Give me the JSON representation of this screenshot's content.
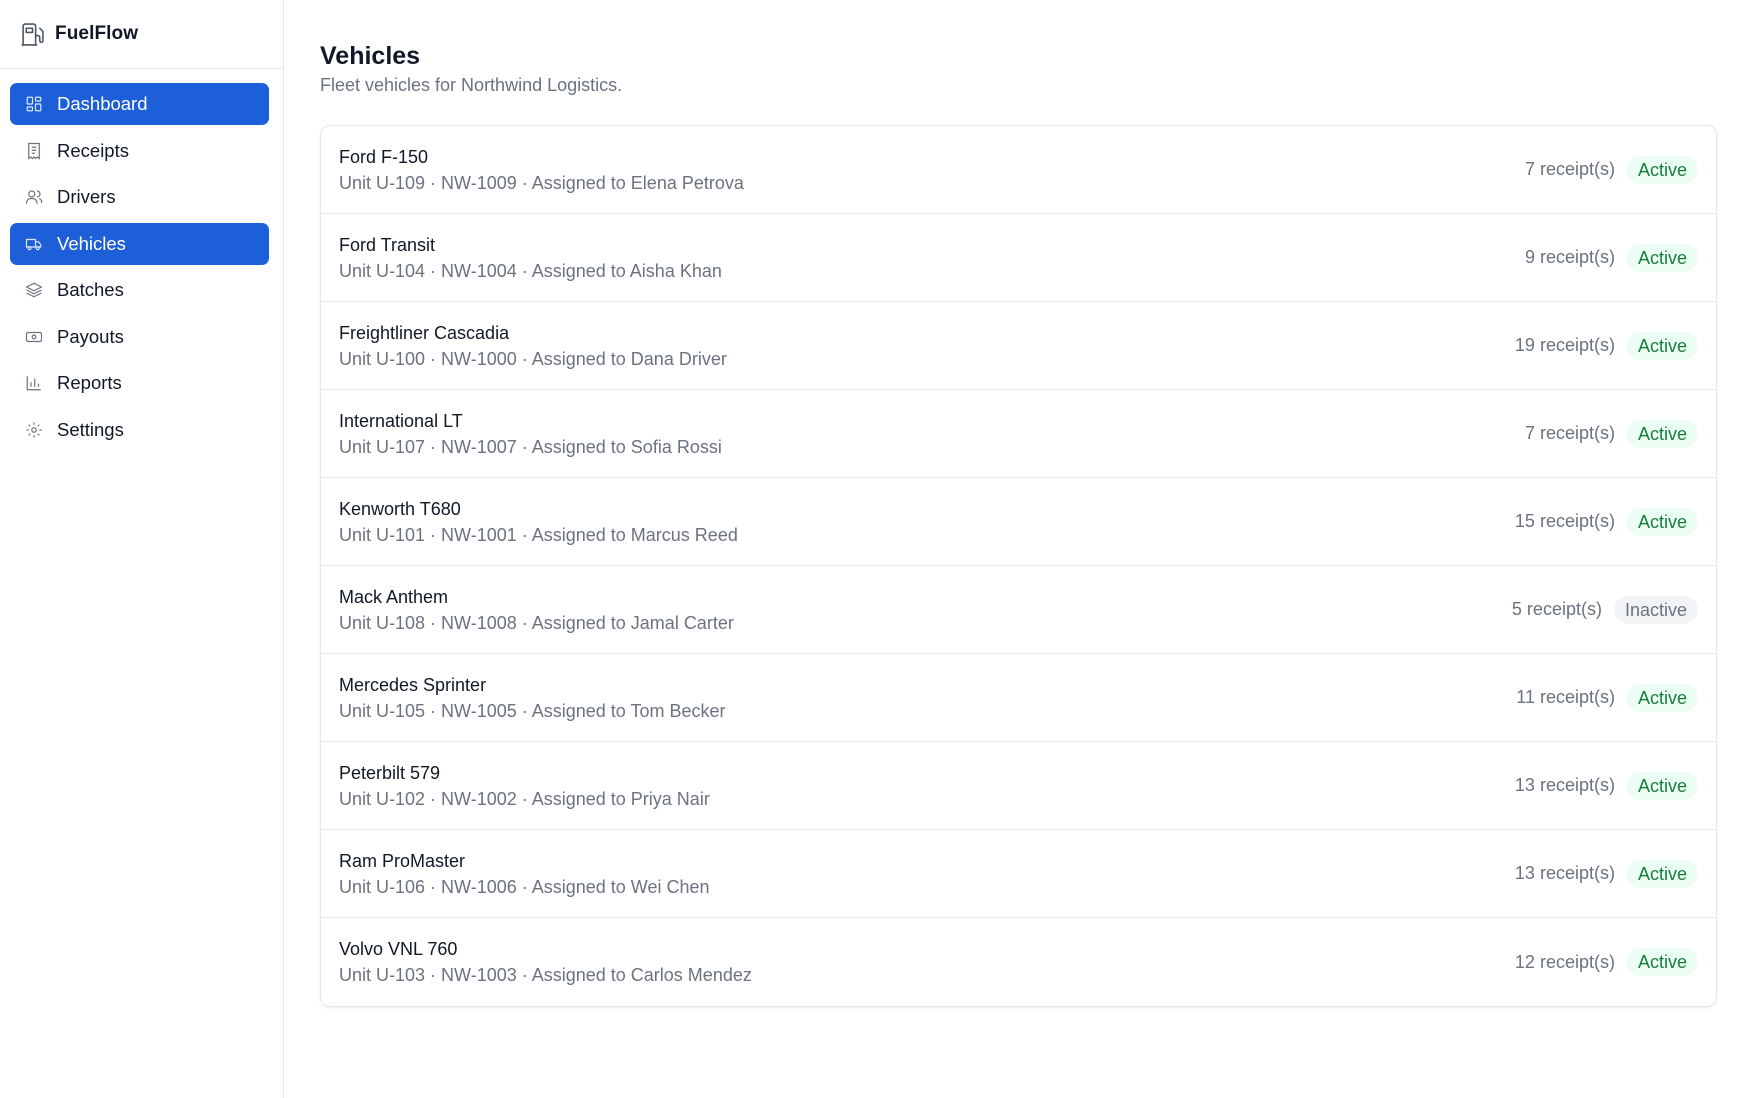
{
  "app": {
    "name": "FuelFlow"
  },
  "sidebar": {
    "items": [
      {
        "label": "Dashboard",
        "icon": "dashboard-icon",
        "active": true
      },
      {
        "label": "Receipts",
        "icon": "receipt-icon",
        "active": false
      },
      {
        "label": "Drivers",
        "icon": "users-icon",
        "active": false
      },
      {
        "label": "Vehicles",
        "icon": "truck-icon",
        "active": true
      },
      {
        "label": "Batches",
        "icon": "layers-icon",
        "active": false
      },
      {
        "label": "Payouts",
        "icon": "banknote-icon",
        "active": false
      },
      {
        "label": "Reports",
        "icon": "bar-chart-icon",
        "active": false
      },
      {
        "label": "Settings",
        "icon": "gear-icon",
        "active": false
      }
    ]
  },
  "page": {
    "title": "Vehicles",
    "subtitle": "Fleet vehicles for Northwind Logistics."
  },
  "vehicles": [
    {
      "name": "Ford F-150",
      "meta": "Unit U-109 · NW-1009 · Assigned to Elena Petrova",
      "receipts": "7 receipt(s)",
      "status": "Active"
    },
    {
      "name": "Ford Transit",
      "meta": "Unit U-104 · NW-1004 · Assigned to Aisha Khan",
      "receipts": "9 receipt(s)",
      "status": "Active"
    },
    {
      "name": "Freightliner Cascadia",
      "meta": "Unit U-100 · NW-1000 · Assigned to Dana Driver",
      "receipts": "19 receipt(s)",
      "status": "Active"
    },
    {
      "name": "International LT",
      "meta": "Unit U-107 · NW-1007 · Assigned to Sofia Rossi",
      "receipts": "7 receipt(s)",
      "status": "Active"
    },
    {
      "name": "Kenworth T680",
      "meta": "Unit U-101 · NW-1001 · Assigned to Marcus Reed",
      "receipts": "15 receipt(s)",
      "status": "Active"
    },
    {
      "name": "Mack Anthem",
      "meta": "Unit U-108 · NW-1008 · Assigned to Jamal Carter",
      "receipts": "5 receipt(s)",
      "status": "Inactive"
    },
    {
      "name": "Mercedes Sprinter",
      "meta": "Unit U-105 · NW-1005 · Assigned to Tom Becker",
      "receipts": "11 receipt(s)",
      "status": "Active"
    },
    {
      "name": "Peterbilt 579",
      "meta": "Unit U-102 · NW-1002 · Assigned to Priya Nair",
      "receipts": "13 receipt(s)",
      "status": "Active"
    },
    {
      "name": "Ram ProMaster",
      "meta": "Unit U-106 · NW-1006 · Assigned to Wei Chen",
      "receipts": "13 receipt(s)",
      "status": "Active"
    },
    {
      "name": "Volvo VNL 760",
      "meta": "Unit U-103 · NW-1003 · Assigned to Carlos Mendez",
      "receipts": "12 receipt(s)",
      "status": "Active"
    }
  ],
  "colors": {
    "accent": "#1d5fd8",
    "active_badge_text": "#15803d",
    "active_badge_bg": "#ecfdf3",
    "inactive_badge_text": "#6b7280",
    "inactive_badge_bg": "#f3f4f6"
  }
}
